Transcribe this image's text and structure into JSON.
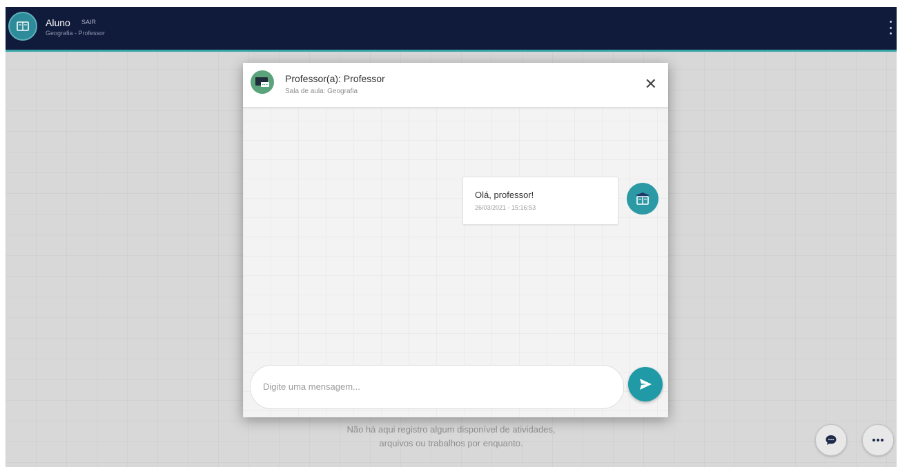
{
  "header": {
    "user_name": "Aluno",
    "logout_label": "SAIR",
    "subtitle": "Geografia - Professor"
  },
  "chat": {
    "title": "Professor(a): Professor",
    "subtitle": "Sala de aula: Geografia",
    "close_symbol": "✕",
    "messages": [
      {
        "text": "Olá, professor!",
        "timestamp": "26/03/2021 - 15:16:53"
      }
    ],
    "input_placeholder": "Digite uma mensagem..."
  },
  "empty_state": {
    "line1": "Não há aqui registro algum disponível de atividades,",
    "line2": "arquivos ou trabalhos por enquanto."
  },
  "icons": {
    "header_avatar": "book-icon",
    "teacher_avatar": "chalkboard-icon",
    "message_avatar": "student-book-icon",
    "send": "send-icon",
    "chat_fab": "chat-bubble-icon",
    "more_fab": "more-dots-icon",
    "menu": "kebab-menu-icon"
  },
  "colors": {
    "topbar": "#101a3a",
    "accent": "#1f9aa6",
    "teacher_avatar": "#5aa37b"
  }
}
